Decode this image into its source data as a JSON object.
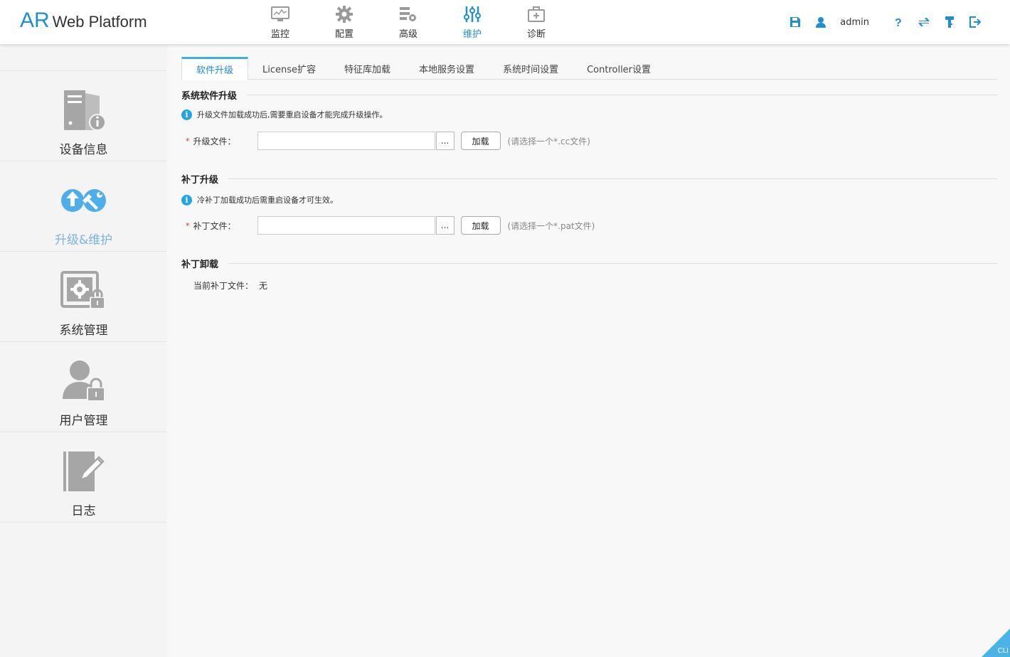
{
  "app": {
    "logo_ar": "AR",
    "logo_rest": "Web Platform"
  },
  "topnav": [
    {
      "id": "monitor",
      "label": "监控",
      "icon": "monitor-icon"
    },
    {
      "id": "config",
      "label": "配置",
      "icon": "gear-icon"
    },
    {
      "id": "advanced",
      "label": "高级",
      "icon": "advanced-icon"
    },
    {
      "id": "maintain",
      "label": "维护",
      "icon": "sliders-icon",
      "active": true
    },
    {
      "id": "diagnose",
      "label": "诊断",
      "icon": "first-aid-icon"
    }
  ],
  "toolbar": {
    "username": "admin"
  },
  "sidebar": [
    {
      "label": "设备信息",
      "icon": "device-info-icon"
    },
    {
      "label": "升级&维护",
      "icon": "upgrade-maintain-icon",
      "active": true
    },
    {
      "label": "系统管理",
      "icon": "system-manage-icon"
    },
    {
      "label": "用户管理",
      "icon": "user-manage-icon"
    },
    {
      "label": "日志",
      "icon": "log-icon"
    }
  ],
  "tabs": [
    {
      "label": "软件升级",
      "active": true
    },
    {
      "label": "License扩容"
    },
    {
      "label": "特征库加载"
    },
    {
      "label": "本地服务设置"
    },
    {
      "label": "系统时间设置"
    },
    {
      "label": "Controller设置"
    }
  ],
  "software_upgrade": {
    "title": "系统软件升级",
    "info": "升级文件加载成功后,需要重启设备才能完成升级操作。",
    "required_mark": "*",
    "label": "升级文件：",
    "value": "",
    "browse_label": "...",
    "load_label": "加载",
    "hint": "(请选择一个*.cc文件)"
  },
  "patch_upgrade": {
    "title": "补丁升级",
    "info": "冷补丁加载成功后需重启设备才可生效。",
    "required_mark": "*",
    "label": "补丁文件：",
    "value": "",
    "browse_label": "...",
    "load_label": "加载",
    "hint": "(请选择一个*.pat文件)"
  },
  "patch_unload": {
    "title": "补丁卸载",
    "current_label": "当前补丁文件：",
    "current_value": "无"
  },
  "cli": {
    "label": "CLI"
  },
  "colors": {
    "brand": "#1e8fd0",
    "accent": "#21a6e2",
    "active_sidebar": "#7ab5e0",
    "required": "#e0302e"
  }
}
